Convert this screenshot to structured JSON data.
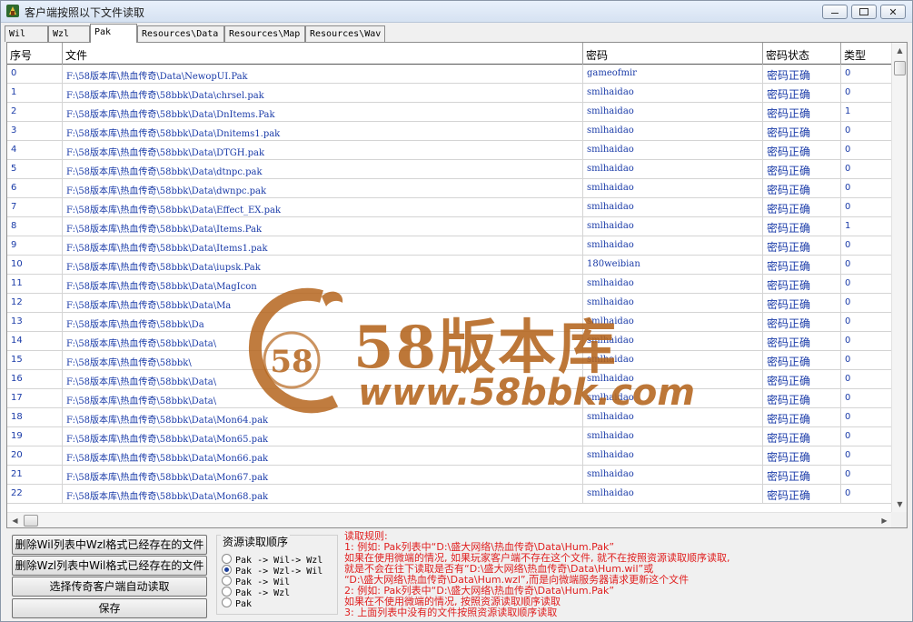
{
  "window": {
    "title": "客户端按照以下文件读取",
    "minimize_icon": "minimize-icon",
    "restore_icon": "restore-icon",
    "close_icon": "close-icon",
    "close_glyph": "✕"
  },
  "tabs": [
    {
      "label": "Wil"
    },
    {
      "label": "Wzl"
    },
    {
      "label": "Pak"
    },
    {
      "label": "Resources\\Data"
    },
    {
      "label": "Resources\\Map"
    },
    {
      "label": "Resources\\Wav"
    }
  ],
  "table": {
    "headers": [
      "序号",
      "文件",
      "密码",
      "密码状态",
      "类型"
    ],
    "rows": [
      {
        "idx": "0",
        "file": "F:\\58版本库\\热血传奇\\Data\\NewopUI.Pak",
        "pwd": "gameofmir",
        "status": "密码正确",
        "type": "0"
      },
      {
        "idx": "1",
        "file": "F:\\58版本库\\热血传奇\\58bbk\\Data\\chrsel.pak",
        "pwd": "smlhaidao",
        "status": "密码正确",
        "type": "0"
      },
      {
        "idx": "2",
        "file": "F:\\58版本库\\热血传奇\\58bbk\\Data\\DnItems.Pak",
        "pwd": "smlhaidao",
        "status": "密码正确",
        "type": "1"
      },
      {
        "idx": "3",
        "file": "F:\\58版本库\\热血传奇\\58bbk\\Data\\Dnitems1.pak",
        "pwd": "smlhaidao",
        "status": "密码正确",
        "type": "0"
      },
      {
        "idx": "4",
        "file": "F:\\58版本库\\热血传奇\\58bbk\\Data\\DTGH.pak",
        "pwd": "smlhaidao",
        "status": "密码正确",
        "type": "0"
      },
      {
        "idx": "5",
        "file": "F:\\58版本库\\热血传奇\\58bbk\\Data\\dtnpc.pak",
        "pwd": "smlhaidao",
        "status": "密码正确",
        "type": "0"
      },
      {
        "idx": "6",
        "file": "F:\\58版本库\\热血传奇\\58bbk\\Data\\dwnpc.pak",
        "pwd": "smlhaidao",
        "status": "密码正确",
        "type": "0"
      },
      {
        "idx": "7",
        "file": "F:\\58版本库\\热血传奇\\58bbk\\Data\\Effect_EX.pak",
        "pwd": "smlhaidao",
        "status": "密码正确",
        "type": "0"
      },
      {
        "idx": "8",
        "file": "F:\\58版本库\\热血传奇\\58bbk\\Data\\Items.Pak",
        "pwd": "smlhaidao",
        "status": "密码正确",
        "type": "1"
      },
      {
        "idx": "9",
        "file": "F:\\58版本库\\热血传奇\\58bbk\\Data\\Items1.pak",
        "pwd": "smlhaidao",
        "status": "密码正确",
        "type": "0"
      },
      {
        "idx": "10",
        "file": "F:\\58版本库\\热血传奇\\58bbk\\Data\\iupsk.Pak",
        "pwd": "180weibian",
        "status": "密码正确",
        "type": "0"
      },
      {
        "idx": "11",
        "file": "F:\\58版本库\\热血传奇\\58bbk\\Data\\MagIcon",
        "pwd": "smlhaidao",
        "status": "密码正确",
        "type": "0"
      },
      {
        "idx": "12",
        "file": "F:\\58版本库\\热血传奇\\58bbk\\Data\\Ma",
        "pwd": "smlhaidao",
        "status": "密码正确",
        "type": "0"
      },
      {
        "idx": "13",
        "file": "F:\\58版本库\\热血传奇\\58bbk\\Da",
        "pwd": "smlhaidao",
        "status": "密码正确",
        "type": "0"
      },
      {
        "idx": "14",
        "file": "F:\\58版本库\\热血传奇\\58bbk\\Data\\",
        "pwd": "smlhaidao",
        "status": "密码正确",
        "type": "0"
      },
      {
        "idx": "15",
        "file": "F:\\58版本库\\热血传奇\\58bbk\\",
        "pwd": "smlhaidao",
        "status": "密码正确",
        "type": "0"
      },
      {
        "idx": "16",
        "file": "F:\\58版本库\\热血传奇\\58bbk\\Data\\",
        "pwd": "smlhaidao",
        "status": "密码正确",
        "type": "0"
      },
      {
        "idx": "17",
        "file": "F:\\58版本库\\热血传奇\\58bbk\\Data\\",
        "pwd": "smlhaidao",
        "status": "密码正确",
        "type": "0"
      },
      {
        "idx": "18",
        "file": "F:\\58版本库\\热血传奇\\58bbk\\Data\\Mon64.pak",
        "pwd": "smlhaidao",
        "status": "密码正确",
        "type": "0"
      },
      {
        "idx": "19",
        "file": "F:\\58版本库\\热血传奇\\58bbk\\Data\\Mon65.pak",
        "pwd": "smlhaidao",
        "status": "密码正确",
        "type": "0"
      },
      {
        "idx": "20",
        "file": "F:\\58版本库\\热血传奇\\58bbk\\Data\\Mon66.pak",
        "pwd": "smlhaidao",
        "status": "密码正确",
        "type": "0"
      },
      {
        "idx": "21",
        "file": "F:\\58版本库\\热血传奇\\58bbk\\Data\\Mon67.pak",
        "pwd": "smlhaidao",
        "status": "密码正确",
        "type": "0"
      },
      {
        "idx": "22",
        "file": "F:\\58版本库\\热血传奇\\58bbk\\Data\\Mon68.pak",
        "pwd": "smlhaidao",
        "status": "密码正确",
        "type": "0"
      }
    ]
  },
  "watermark": {
    "logo_number": "58",
    "main": "58版本库",
    "url": "www.58bbk.com"
  },
  "buttons": {
    "delete_wil": "删除Wil列表中Wzl格式已经存在的文件",
    "delete_wzl": "删除Wzl列表中Wil格式已经存在的文件",
    "select_client": "选择传奇客户端自动读取",
    "save": "保存"
  },
  "read_order": {
    "title": "资源读取顺序",
    "options": [
      {
        "label": "Pak -> Wil-> Wzl",
        "selected": false
      },
      {
        "label": "Pak -> Wzl-> Wil",
        "selected": true
      },
      {
        "label": "Pak -> Wil",
        "selected": false
      },
      {
        "label": "Pak -> Wzl",
        "selected": false
      },
      {
        "label": "Pak",
        "selected": false
      }
    ]
  },
  "rules": {
    "lines": [
      "读取规则:",
      "1: 例如: Pak列表中“D:\\盛大网络\\热血传奇\\Data\\Hum.Pak”",
      "    如果在使用微端的情况, 如果玩家客户端不存在这个文件, 就不在按照资源读取顺序读取,",
      "    就是不会在往下读取是否有“D:\\盛大网络\\热血传奇\\Data\\Hum.wil”或",
      "   “D:\\盛大网络\\热血传奇\\Data\\Hum.wzl”,而是向微端服务器请求更新这个文件",
      "2: 例如: Pak列表中“D:\\盛大网络\\热血传奇\\Data\\Hum.Pak”",
      "    如果在不使用微端的情况, 按照资源读取顺序读取",
      "3: 上面列表中没有的文件按照资源读取顺序读取"
    ]
  },
  "colors": {
    "link_blue": "#1a3ba8",
    "rules_red": "#e02020",
    "watermark_brown": "#b5651d"
  }
}
